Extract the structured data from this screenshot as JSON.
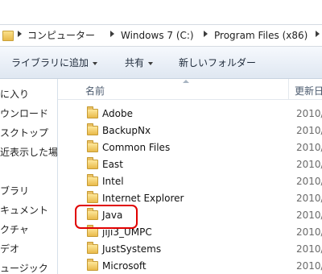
{
  "address": {
    "crumbs": [
      "コンピューター",
      "Windows 7 (C:)",
      "Program Files (x86)"
    ]
  },
  "toolbar": {
    "library_label": "ライブラリに追加",
    "share_label": "共有",
    "new_folder_label": "新しいフォルダー"
  },
  "nav": {
    "items": [
      "に入り",
      "ウンロード",
      "スクトップ",
      "近表示した場所",
      "ブラリ",
      "キュメント",
      "クチャ",
      "デオ",
      "ュージック"
    ]
  },
  "columns": {
    "name": "名前",
    "date": "更新日"
  },
  "files": [
    {
      "name": "Adobe",
      "date": "2010/"
    },
    {
      "name": "BackupNx",
      "date": "2010/"
    },
    {
      "name": "Common Files",
      "date": "2010/"
    },
    {
      "name": "East",
      "date": "2010/"
    },
    {
      "name": "Intel",
      "date": "2010/"
    },
    {
      "name": "Internet Explorer",
      "date": "2010/"
    },
    {
      "name": "Java",
      "date": "2010/"
    },
    {
      "name": "jiji3_UMPC",
      "date": "2010/"
    },
    {
      "name": "JustSystems",
      "date": "2010/"
    },
    {
      "name": "Microsoft",
      "date": "2010/"
    }
  ],
  "colors": {
    "highlight": "#e00000",
    "folder": "#e9ba4a"
  }
}
